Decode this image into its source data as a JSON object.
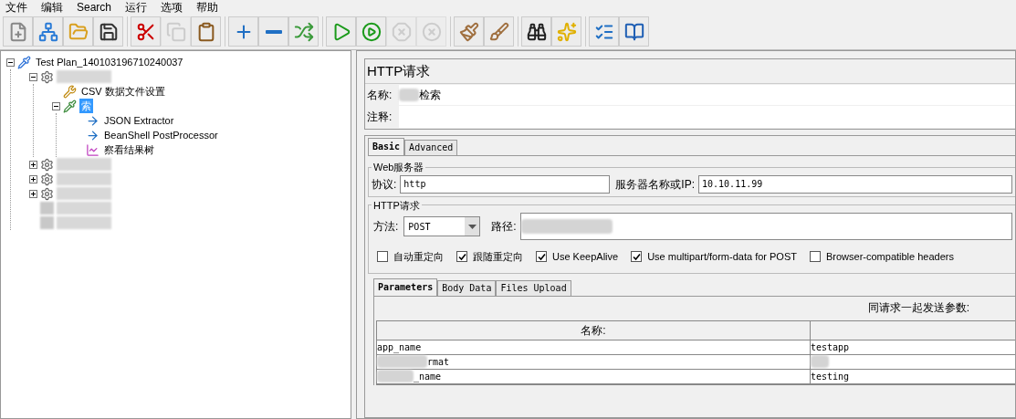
{
  "menu": [
    "文件",
    "编辑",
    "Search",
    "运行",
    "选项",
    "帮助"
  ],
  "toolbar": [
    [
      {
        "disabled": false
      },
      {
        "disabled": false
      },
      {
        "disabled": false
      },
      {
        "disabled": false
      }
    ],
    [
      {
        "disabled": false
      },
      {
        "disabled": true
      },
      {
        "disabled": false
      }
    ],
    [
      {
        "disabled": false
      },
      {
        "disabled": false
      },
      {
        "disabled": false
      }
    ],
    [
      {
        "disabled": false
      },
      {
        "disabled": false
      },
      {
        "disabled": true
      },
      {
        "disabled": true
      }
    ],
    [
      {
        "disabled": false
      },
      {
        "disabled": false
      }
    ],
    [
      {
        "disabled": false
      },
      {
        "disabled": false
      }
    ],
    [
      {
        "disabled": false
      },
      {
        "disabled": false
      }
    ]
  ],
  "tree": [
    {
      "kind": "plan",
      "label": "Test Plan_140103196710240037",
      "expanded": true,
      "selected": false,
      "children": [
        {
          "kind": "thread-group",
          "expanded": true,
          "selected": false,
          "children": [
            {
              "kind": "config",
              "label": "CSV 数据文件设置",
              "selected": false
            },
            {
              "kind": "sampler",
              "label": "索",
              "expanded": true,
              "selected": true,
              "children": [
                {
                  "kind": "extractor",
                  "label": "JSON Extractor",
                  "selected": false
                },
                {
                  "kind": "extractor",
                  "label": "BeanShell PostProcessor",
                  "selected": false
                },
                {
                  "kind": "listener",
                  "label": "察看结果树",
                  "selected": false
                }
              ]
            }
          ]
        },
        {
          "kind": "thread-group",
          "expanded": false,
          "selected": false
        },
        {
          "kind": "thread-group",
          "expanded": false,
          "selected": false
        },
        {
          "kind": "thread-group",
          "expanded": false,
          "selected": false
        },
        {
          "kind": "hidden",
          "selected": false
        },
        {
          "kind": "hidden",
          "selected": false
        }
      ]
    }
  ],
  "panel": {
    "title": "HTTP请求",
    "name_label": "名称:",
    "name_value": "检索",
    "comment_label": "注释:",
    "tabs": [
      {
        "label": "Basic",
        "selected": true
      },
      {
        "label": "Advanced",
        "selected": false
      }
    ],
    "web_server": {
      "legend": "Web服务器",
      "protocol_label": "协议:",
      "protocol": "http",
      "server_label": "服务器名称或IP:",
      "server": "10.10.11.99"
    },
    "http_request": {
      "legend": "HTTP请求",
      "method_label": "方法:",
      "method": "POST",
      "path_label": "路径:",
      "options": [
        {
          "label": "自动重定向",
          "checked": false
        },
        {
          "label": "跟随重定向",
          "checked": true
        },
        {
          "label": "Use KeepAlive",
          "checked": true
        },
        {
          "label": "Use multipart/form-data for POST",
          "checked": true
        },
        {
          "label": "Browser-compatible headers",
          "checked": false
        }
      ]
    },
    "sub_tabs": [
      {
        "label": "Parameters",
        "selected": true
      },
      {
        "label": "Body Data",
        "selected": false
      },
      {
        "label": "Files Upload",
        "selected": false
      }
    ],
    "params_caption": "同请求一起发送参数:",
    "table": {
      "columns": [
        "名称:"
      ],
      "rows": [
        {
          "name": "app_name",
          "value": "testapp"
        },
        {
          "name": "rmat"
        },
        {
          "name": "_name",
          "value": "testing"
        }
      ]
    }
  }
}
